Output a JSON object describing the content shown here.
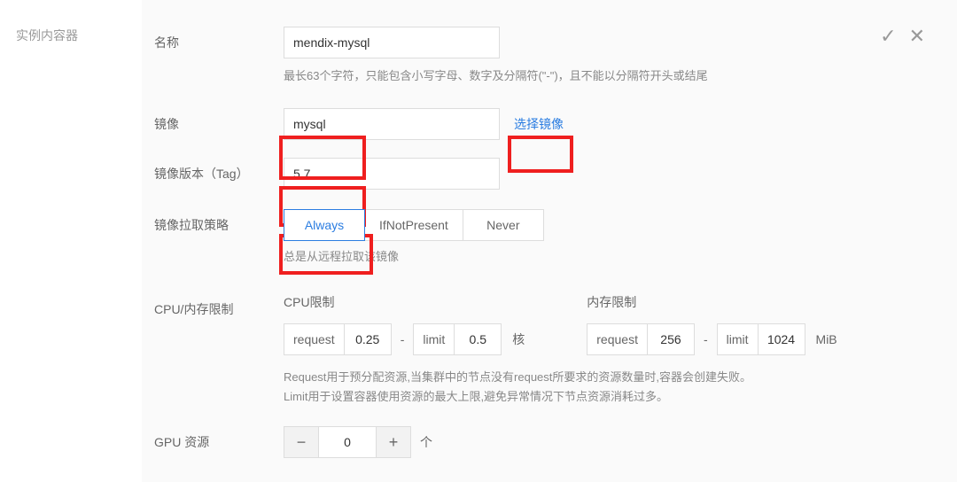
{
  "sectionTitle": "实例内容器",
  "fields": {
    "nameLabel": "名称",
    "nameValue": "mendix-mysql",
    "nameHelp": "最长63个字符，只能包含小写字母、数字及分隔符(\"-\")，且不能以分隔符开头或结尾",
    "imageLabel": "镜像",
    "imageValue": "mysql",
    "selectImage": "选择镜像",
    "tagLabel": "镜像版本（Tag）",
    "tagValue": "5.7",
    "pullPolicyLabel": "镜像拉取策略",
    "pullPolicyHelp": "总是从远程拉取该镜像",
    "policies": {
      "p1": "Always",
      "p2": "IfNotPresent",
      "p3": "Never"
    },
    "cpuMemLabel": "CPU/内存限制",
    "cpuTitle": "CPU限制",
    "memTitle": "内存限制",
    "requestLabel": "request",
    "limitLabel": "limit",
    "cpuRequest": "0.25",
    "cpuLimit": "0.5",
    "cpuUnit": "核",
    "memRequest": "256",
    "memLimit": "1024",
    "memUnit": "MiB",
    "resourceHelp1": "Request用于预分配资源,当集群中的节点没有request所要求的资源数量时,容器会创建失败。",
    "resourceHelp2": "Limit用于设置容器使用资源的最大上限,避免异常情况下节点资源消耗过多。",
    "gpuLabel": "GPU 资源",
    "gpuValue": "0",
    "gpuUnit": "个"
  }
}
